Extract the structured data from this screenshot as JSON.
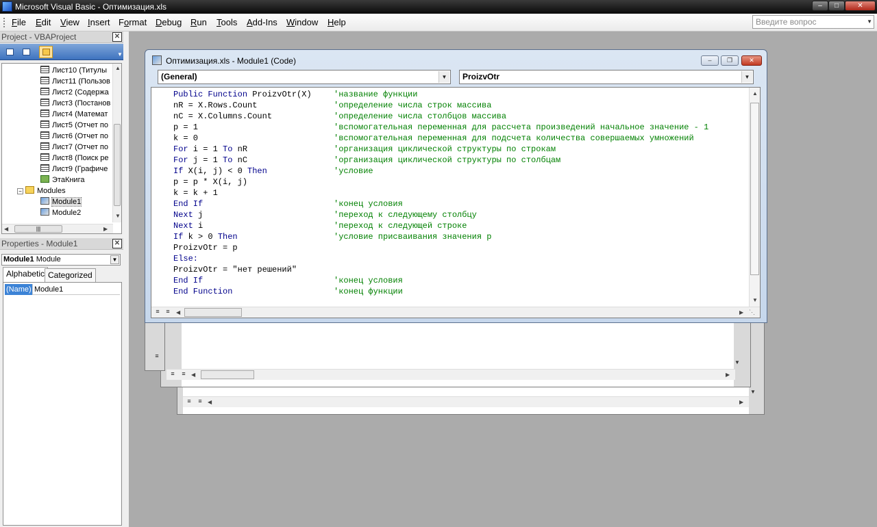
{
  "window": {
    "title": "Microsoft Visual Basic - Оптимизация.xls"
  },
  "menu": [
    "File",
    "Edit",
    "View",
    "Insert",
    "Format",
    "Debug",
    "Run",
    "Tools",
    "Add-Ins",
    "Window",
    "Help"
  ],
  "menu_mnemonic": [
    "F",
    "E",
    "V",
    "I",
    "o",
    "D",
    "R",
    "T",
    "A",
    "W",
    "H"
  ],
  "ask_box": {
    "placeholder": "Введите вопрос"
  },
  "project_pane": {
    "title": "Project - VBAProject",
    "tree": [
      {
        "label": "Лист10 (Титулы",
        "type": "sheet"
      },
      {
        "label": "Лист11 (Пользов",
        "type": "sheet"
      },
      {
        "label": "Лист2 (Содержа",
        "type": "sheet"
      },
      {
        "label": "Лист3 (Постанов",
        "type": "sheet"
      },
      {
        "label": "Лист4 (Математ",
        "type": "sheet"
      },
      {
        "label": "Лист5 (Отчет по",
        "type": "sheet"
      },
      {
        "label": "Лист6 (Отчет по",
        "type": "sheet"
      },
      {
        "label": "Лист7 (Отчет по",
        "type": "sheet"
      },
      {
        "label": "Лист8 (Поиск ре",
        "type": "sheet"
      },
      {
        "label": "Лист9 (Графиче",
        "type": "sheet"
      },
      {
        "label": "ЭтаКнига",
        "type": "workbook"
      },
      {
        "label": "Modules",
        "type": "folder"
      },
      {
        "label": "Module1",
        "type": "module"
      },
      {
        "label": "Module2",
        "type": "module"
      }
    ]
  },
  "properties_pane": {
    "title": "Properties - Module1",
    "object_name": "Module1",
    "object_type": "Module",
    "tabs": [
      "Alphabetic",
      "Categorized"
    ],
    "rows": [
      {
        "key": "(Name)",
        "value": "Module1"
      }
    ]
  },
  "code_window": {
    "title": "Оптимизация.xls - Module1 (Code)",
    "object_combo": "(General)",
    "proc_combo": "ProizvOtr",
    "lines": [
      {
        "code": [
          [
            "kw",
            "Public Function"
          ],
          [
            "n",
            " ProizvOtr(X)  "
          ]
        ],
        "comment": "'название функции"
      },
      {
        "code": [
          [
            "n",
            "nR = X.Rows.Count"
          ]
        ],
        "comment": "'определение числа строк массива"
      },
      {
        "code": [
          [
            "n",
            "nC = X.Columns.Count"
          ]
        ],
        "comment": "'определение числа столбцов массива"
      },
      {
        "code": [
          [
            "n",
            "p = 1"
          ]
        ],
        "comment": "'вспомогательная переменная для рассчета произведений начальное значение - 1"
      },
      {
        "code": [
          [
            "n",
            "k = 0"
          ]
        ],
        "comment": "'вспомогательная переменная для подсчета количества совершаемых умножений"
      },
      {
        "code": [
          [
            "kw",
            "For"
          ],
          [
            "n",
            " i = 1 "
          ],
          [
            "kw",
            "To"
          ],
          [
            "n",
            " nR"
          ]
        ],
        "comment": "'организация циклической структуры по строкам"
      },
      {
        "code": [
          [
            "kw",
            "For"
          ],
          [
            "n",
            " j = 1 "
          ],
          [
            "kw",
            "To"
          ],
          [
            "n",
            " nC"
          ]
        ],
        "comment": "'организация циклической структуры по столбцам"
      },
      {
        "code": [
          [
            "kw",
            "If"
          ],
          [
            "n",
            " X(i, j) < 0 "
          ],
          [
            "kw",
            "Then"
          ]
        ],
        "comment": "'условие"
      },
      {
        "code": [
          [
            "n",
            "p = p * X(i, j)"
          ]
        ],
        "comment": ""
      },
      {
        "code": [
          [
            "n",
            "k = k + 1"
          ]
        ],
        "comment": ""
      },
      {
        "code": [
          [
            "kw",
            "End If"
          ]
        ],
        "comment": "'конец условия"
      },
      {
        "code": [
          [
            "kw",
            "Next"
          ],
          [
            "n",
            " j"
          ]
        ],
        "comment": "'переход к следующему столбцу"
      },
      {
        "code": [
          [
            "kw",
            "Next"
          ],
          [
            "n",
            " i"
          ]
        ],
        "comment": "'переход к следующей строке"
      },
      {
        "code": [
          [
            "kw",
            "If"
          ],
          [
            "n",
            " k > 0 "
          ],
          [
            "kw",
            "Then"
          ]
        ],
        "comment": "'условие присваивания значения р"
      },
      {
        "code": [
          [
            "n",
            "ProizvOtr = p"
          ]
        ],
        "comment": ""
      },
      {
        "code": [
          [
            "kw",
            "Else:"
          ]
        ],
        "comment": ""
      },
      {
        "code": [
          [
            "n",
            "ProizvOtr = \"нет решений\""
          ]
        ],
        "comment": ""
      },
      {
        "code": [
          [
            "kw",
            "End If"
          ]
        ],
        "comment": "'конец условия"
      },
      {
        "code": [
          [
            "kw",
            "End Function"
          ]
        ],
        "comment": "'конец функции"
      }
    ]
  },
  "colors": {
    "keyword": "#00008b",
    "comment": "#008000",
    "mdi_background": "#ababab"
  }
}
